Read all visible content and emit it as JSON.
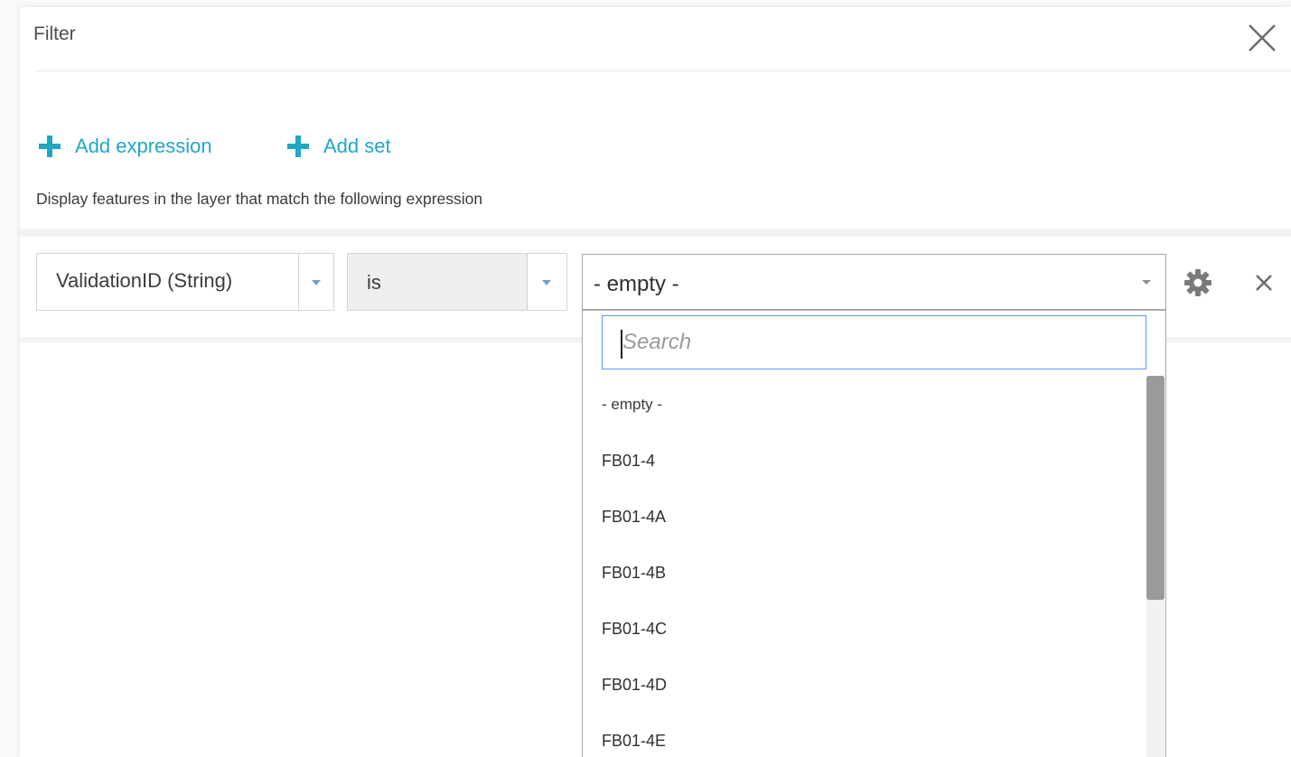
{
  "dialog": {
    "title": "Filter",
    "close_icon": "close-icon"
  },
  "actions": {
    "add_expression": "Add expression",
    "add_set": "Add set",
    "icon": "plus-icon"
  },
  "description": "Display features in the layer that match the following expression",
  "expression": {
    "field": "ValidationID (String)",
    "operator": "is",
    "value": "- empty -",
    "settings_icon": "gear-icon",
    "remove_icon": "close-icon"
  },
  "dropdown": {
    "search_placeholder": "Search",
    "options": [
      "- empty -",
      "FB01-4",
      "FB01-4A",
      "FB01-4B",
      "FB01-4C",
      "FB01-4D",
      "FB01-4E"
    ]
  },
  "colors": {
    "accent": "#1fa7c6",
    "focus_border": "#5897fb",
    "scroll_thumb": "#9a9a9a"
  }
}
